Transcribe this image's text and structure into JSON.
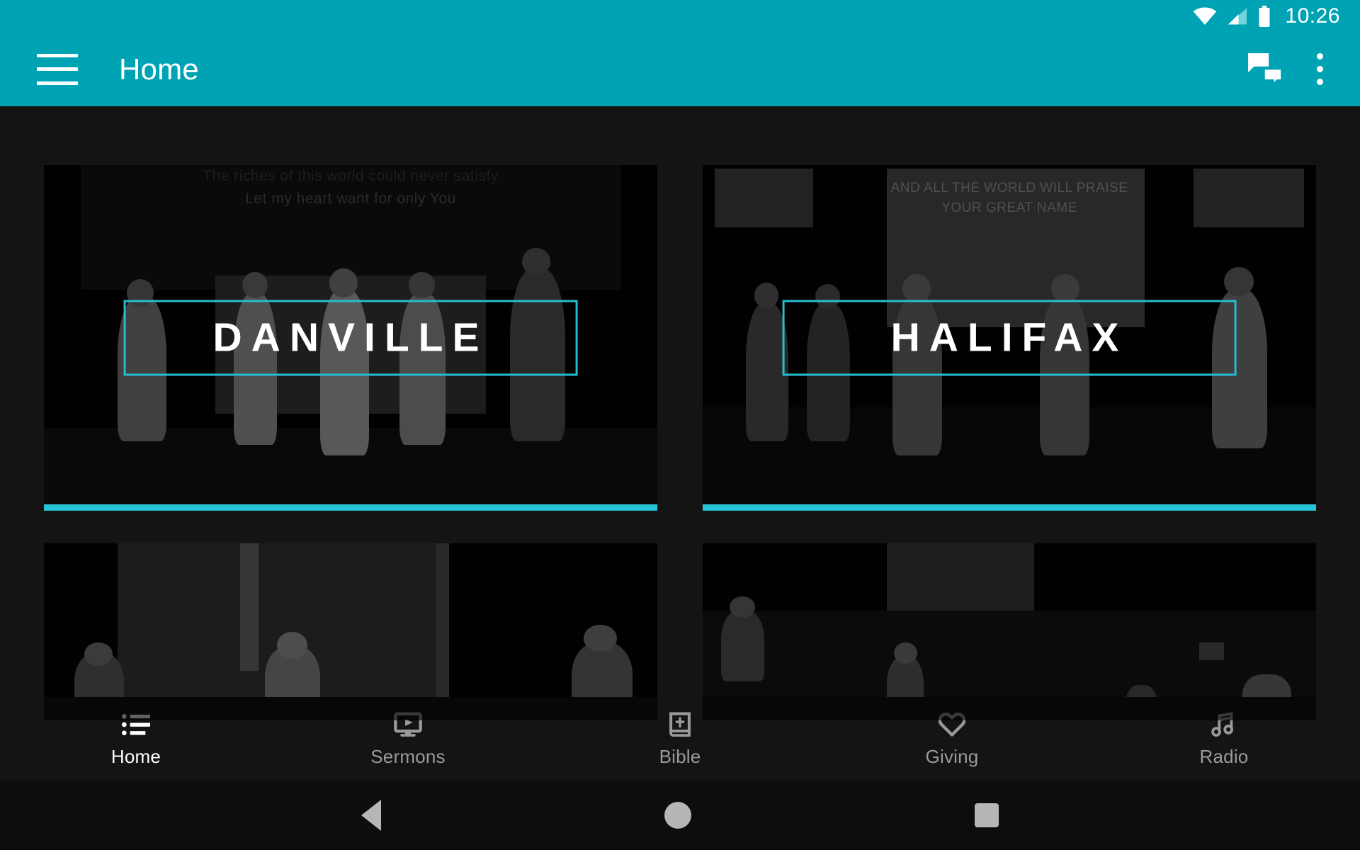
{
  "status_bar": {
    "clock": "10:26",
    "icons": [
      "wifi-icon",
      "cellular-signal-icon",
      "battery-icon"
    ]
  },
  "app_bar": {
    "menu_icon": "hamburger-menu-icon",
    "title": "Home",
    "chat_icon": "chat-bubbles-icon",
    "overflow_icon": "overflow-menu-icon",
    "background_color": "#00A3B4"
  },
  "theme": {
    "accent": "#29C3D8",
    "label_border": "#27BDD1",
    "background": "#141414",
    "primary": "#00A3B4"
  },
  "main": {
    "cards": [
      {
        "label": "DANVILLE",
        "lyrics_line_1": "The riches of this world could never satisfy",
        "lyrics_line_2": "Let my heart want for only You",
        "has_accent_bar": true
      },
      {
        "label": "HALIFAX",
        "lyrics_line_1": "AND ALL THE WORLD WILL PRAISE",
        "lyrics_line_2": "YOUR GREAT NAME",
        "has_accent_bar": true
      },
      {
        "label": "",
        "lyrics_line_1": "",
        "lyrics_line_2": "",
        "has_accent_bar": false
      },
      {
        "label": "",
        "lyrics_line_1": "",
        "lyrics_line_2": "",
        "has_accent_bar": false
      }
    ]
  },
  "bottom_nav": {
    "items": [
      {
        "label": "Home",
        "icon": "list-icon",
        "active": true
      },
      {
        "label": "Sermons",
        "icon": "video-screen-icon",
        "active": false
      },
      {
        "label": "Bible",
        "icon": "bible-book-icon",
        "active": false
      },
      {
        "label": "Giving",
        "icon": "heart-icon",
        "active": false
      },
      {
        "label": "Radio",
        "icon": "music-note-icon",
        "active": false
      }
    ]
  },
  "system_nav": {
    "back": "back-triangle-icon",
    "home": "home-circle-icon",
    "recents": "recents-square-icon"
  }
}
